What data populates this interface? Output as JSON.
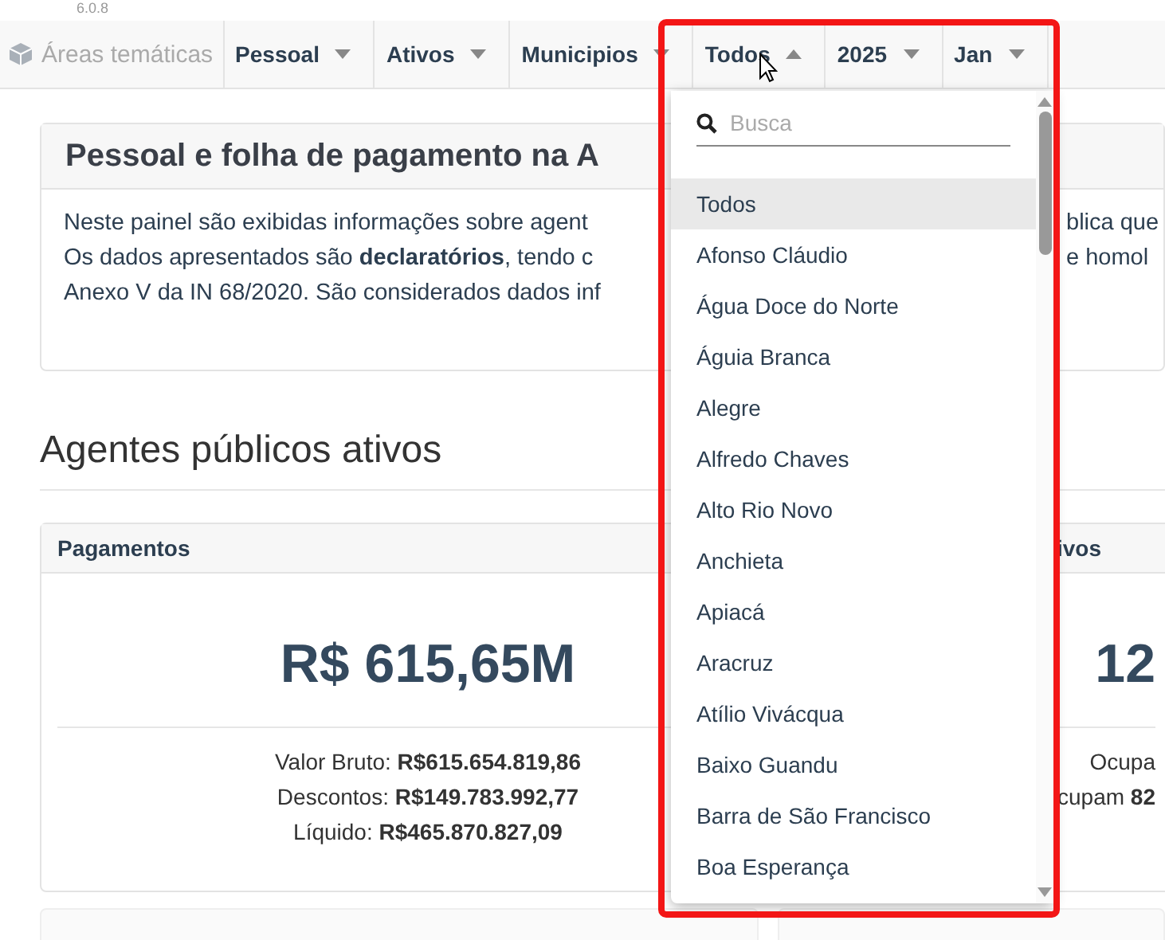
{
  "version": "6.0.8",
  "nav": {
    "brand": "Áreas temáticas",
    "menus": [
      {
        "label": "Pessoal",
        "expanded": false
      },
      {
        "label": "Ativos",
        "expanded": false
      },
      {
        "label": "Municipios",
        "expanded": false
      },
      {
        "label": "Todos",
        "expanded": true
      },
      {
        "label": "2025",
        "expanded": false
      },
      {
        "label": "Jan",
        "expanded": false
      }
    ]
  },
  "intro_card": {
    "title": "Pessoal e folha de pagamento na A",
    "lines": [
      {
        "left": "Neste painel são exibidas informações sobre agent",
        "right": "blica que"
      },
      {
        "left": "Os dados apresentados são **declaratórios**, tendo c",
        "right": "e homol"
      },
      {
        "left": "Anexo V da IN 68/2020. São considerados dados inf"
      }
    ]
  },
  "section_title": "Agentes públicos ativos",
  "cards": [
    {
      "header": "Pagamentos",
      "value": "R$ 615,65M",
      "details": [
        "Valor Bruto: **R$615.654.819,86**",
        "Descontos: **R$149.783.992,77**",
        "Líquido: **R$465.870.827,09**"
      ]
    },
    {
      "header": "ivos",
      "value": "12",
      "details": [
        "Ocupa",
        "cupam **82**"
      ]
    }
  ],
  "dropdown": {
    "search": {
      "placeholder": "Busca"
    },
    "options": [
      {
        "label": "Todos",
        "selected": true
      },
      {
        "label": "Afonso Cláudio",
        "selected": false
      },
      {
        "label": "Água Doce do Norte",
        "selected": false
      },
      {
        "label": "Águia Branca",
        "selected": false
      },
      {
        "label": "Alegre",
        "selected": false
      },
      {
        "label": "Alfredo Chaves",
        "selected": false
      },
      {
        "label": "Alto Rio Novo",
        "selected": false
      },
      {
        "label": "Anchieta",
        "selected": false
      },
      {
        "label": "Apiacá",
        "selected": false
      },
      {
        "label": "Aracruz",
        "selected": false
      },
      {
        "label": "Atílio Vivácqua",
        "selected": false
      },
      {
        "label": "Baixo Guandu",
        "selected": false
      },
      {
        "label": "Barra de São Francisco",
        "selected": false
      },
      {
        "label": "Boa Esperança",
        "selected": false
      }
    ]
  }
}
